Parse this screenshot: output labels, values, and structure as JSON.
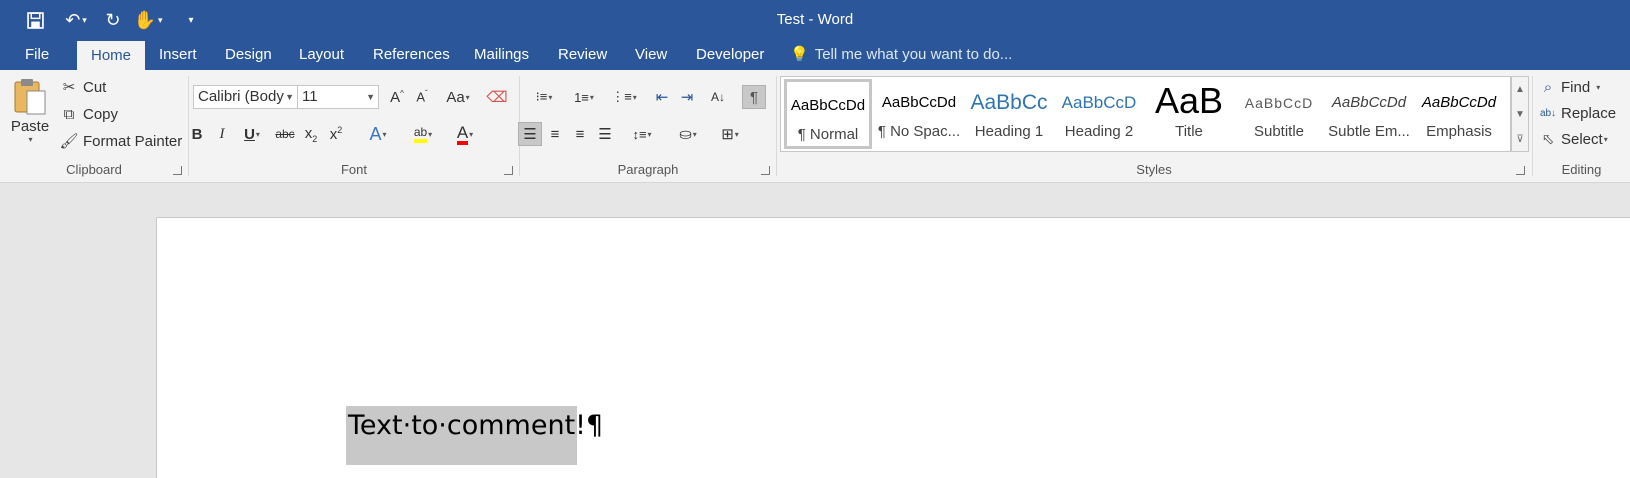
{
  "window": {
    "title": "Test - Word"
  },
  "qat": {
    "icons": [
      "save-icon",
      "undo-icon",
      "redo-icon",
      "touch-mode-icon",
      "customize-qat-icon"
    ]
  },
  "tabs": [
    "File",
    "Home",
    "Insert",
    "Design",
    "Layout",
    "References",
    "Mailings",
    "Review",
    "View",
    "Developer"
  ],
  "active_tab": "Home",
  "tell_me": {
    "placeholder": "Tell me what you want to do..."
  },
  "clipboard": {
    "paste": "Paste",
    "cut": "Cut",
    "copy": "Copy",
    "format_painter": "Format Painter",
    "label": "Clipboard"
  },
  "font": {
    "name": "Calibri (Body",
    "size": "11",
    "label": "Font",
    "change_case": "Aa"
  },
  "paragraph": {
    "label": "Paragraph"
  },
  "styles": {
    "label": "Styles",
    "items": [
      {
        "preview": "AaBbCcDd",
        "name": "¶ Normal"
      },
      {
        "preview": "AaBbCcDd",
        "name": "¶ No Spac..."
      },
      {
        "preview": "AaBbCc",
        "name": "Heading 1"
      },
      {
        "preview": "AaBbCcD",
        "name": "Heading 2"
      },
      {
        "preview": "AaB",
        "name": "Title"
      },
      {
        "preview": "AaBbCcD",
        "name": "Subtitle"
      },
      {
        "preview": "AaBbCcDd",
        "name": "Subtle Em..."
      },
      {
        "preview": "AaBbCcDd",
        "name": "Emphasis"
      }
    ]
  },
  "editing": {
    "find": "Find",
    "replace": "Replace",
    "select": "Select",
    "label": "Editing"
  },
  "document": {
    "text": "Text·to·comment!¶"
  },
  "colors": {
    "brand": "#2b579a",
    "highlight": "#ffff00",
    "font_color": "#ff0000",
    "selection": "#c8c8c8"
  }
}
